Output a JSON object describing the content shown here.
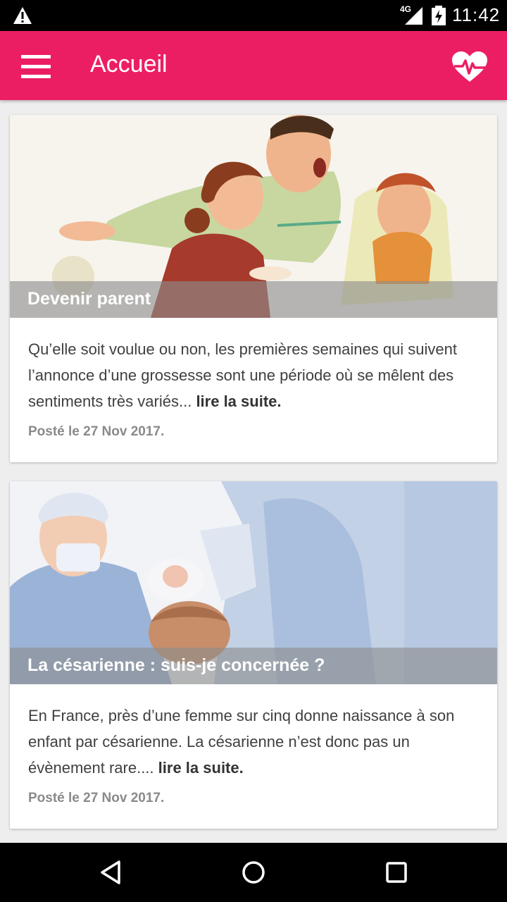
{
  "status_bar": {
    "network": "4G",
    "time": "11:42",
    "icons": [
      "warning-icon",
      "signal-icon",
      "battery-charging-icon"
    ]
  },
  "app_bar": {
    "title": "Accueil",
    "left_icon": "menu-icon",
    "right_icon": "heart-pulse-icon",
    "color": "#ec1e63"
  },
  "posts": [
    {
      "title": "Devenir parent",
      "excerpt": "Qu’elle soit voulue ou non, les premières semaines qui suivent l’annonce d’une grossesse sont une période où se mêlent des sentiments très variés...",
      "read_more": "lire la suite.",
      "date": "Posté le 27 Nov 2017."
    },
    {
      "title": "La césarienne : suis-je concernée ?",
      "excerpt": "En France, près d’une femme sur cinq donne naissance à son enfant par césarienne. La césarienne n’est donc pas un évènement rare....",
      "read_more": "lire la suite.",
      "date": "Posté le 27 Nov 2017."
    }
  ],
  "nav_bar": {
    "buttons": [
      "back-icon",
      "home-icon",
      "recents-icon"
    ]
  }
}
